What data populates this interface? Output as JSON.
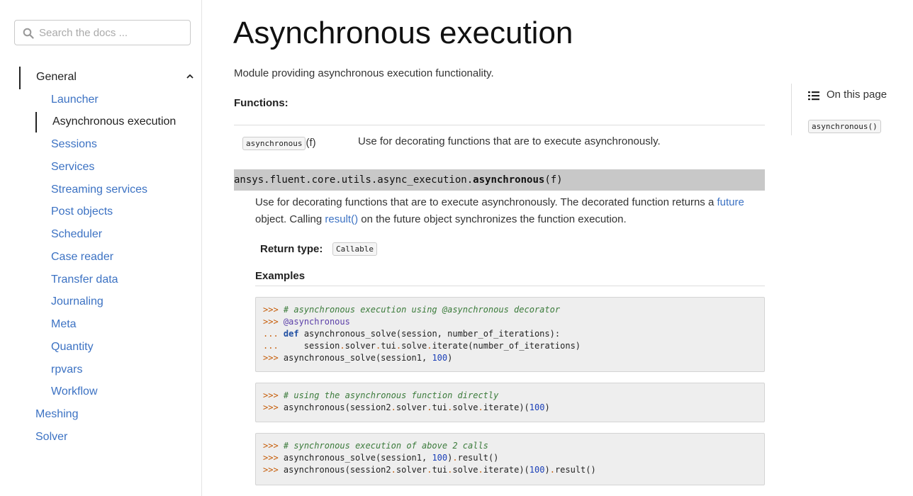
{
  "search": {
    "placeholder": "Search the docs ..."
  },
  "sidebar": {
    "section": "General",
    "items": [
      {
        "label": "Launcher"
      },
      {
        "label": "Asynchronous execution"
      },
      {
        "label": "Sessions"
      },
      {
        "label": "Services"
      },
      {
        "label": "Streaming services"
      },
      {
        "label": "Post objects"
      },
      {
        "label": "Scheduler"
      },
      {
        "label": "Case reader"
      },
      {
        "label": "Transfer data"
      },
      {
        "label": "Journaling"
      },
      {
        "label": "Meta"
      },
      {
        "label": "Quantity"
      },
      {
        "label": "rpvars"
      },
      {
        "label": "Workflow"
      }
    ],
    "top_items": [
      {
        "label": "Meshing"
      },
      {
        "label": "Solver"
      }
    ]
  },
  "main": {
    "title": "Asynchronous execution",
    "intro": "Module providing asynchronous execution functionality.",
    "functions_label": "Functions:",
    "function_row": {
      "name": "asynchronous",
      "arg": "(f)",
      "desc": "Use for decorating functions that are to execute asynchronously."
    },
    "signature": {
      "module": "ansys.fluent.core.utils.async_execution.",
      "name": "asynchronous",
      "params": "(f)"
    },
    "description": {
      "part1": "Use for decorating functions that are to execute asynchronously. The decorated function returns a ",
      "link1": "future",
      "part2": " object. Calling ",
      "link2": "result()",
      "part3": " on the future object synchronizes the function execution."
    },
    "return_type_label": "Return type:",
    "return_type": "Callable",
    "examples_label": "Examples"
  },
  "toc": {
    "title": "On this page",
    "link": "asynchronous()"
  }
}
